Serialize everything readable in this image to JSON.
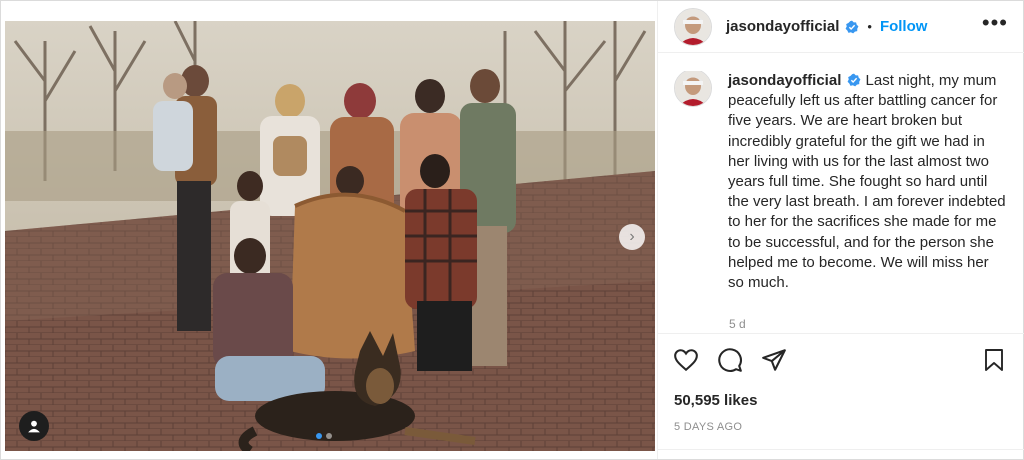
{
  "post": {
    "username": "jasondayofficial",
    "separator": "•",
    "follow_label": "Follow",
    "more_label": "•••",
    "caption": "Last night, my mum peacefully left us after battling cancer for five years. We are heart broken but incredibly grateful for the gift we had in her living with us for the last almost two years full time. She fought so hard until the very last breath. I am forever indebted to her for the sacrifices she made for me to be successful, and for the person she helped me to become. We will miss her so much.",
    "caption_age": "5 d",
    "likes": "50,595 likes",
    "date": "5 DAYS AGO"
  },
  "media": {
    "next_label": "›",
    "carousel": {
      "count": 2,
      "active": 0
    }
  },
  "icons": [
    "heart-icon",
    "comment-icon",
    "share-icon",
    "bookmark-icon",
    "verified-icon",
    "user-tag-icon",
    "chevron-right-icon"
  ],
  "colors": {
    "accent": "#0095f6",
    "verified": "#3897f0",
    "text": "#262626",
    "muted": "#8e8e8e"
  }
}
